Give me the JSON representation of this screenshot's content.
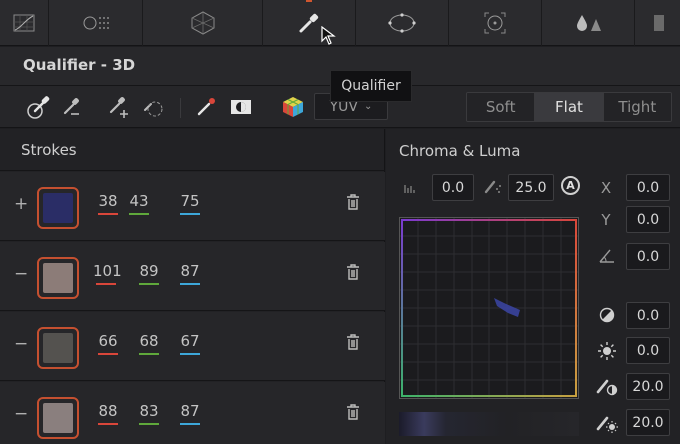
{
  "toolbar": {
    "tabs": [
      {
        "name": "curves-icon"
      },
      {
        "name": "color-warper-icon"
      },
      {
        "name": "hsl-mesh-icon"
      },
      {
        "name": "qualifier-icon",
        "active": true
      },
      {
        "name": "window-icon"
      },
      {
        "name": "tracker-icon"
      },
      {
        "name": "blur-icon"
      },
      {
        "name": "key-icon"
      }
    ],
    "tooltip": "Qualifier"
  },
  "panel": {
    "title": "Qualifier - 3D"
  },
  "tools": {
    "icons": [
      "picker-icon",
      "picker-minus-icon",
      "picker-plus-icon",
      "feather-icon",
      "highlight-pen-icon",
      "invert-mask-icon",
      "color-cube-icon"
    ],
    "color_space": "YUV",
    "softness_options": [
      "Soft",
      "Flat",
      "Tight"
    ],
    "softness_selected": "Flat"
  },
  "strokes": {
    "header": "Strokes",
    "rows": [
      {
        "sign": "+",
        "swatch": "#2a2d66",
        "r": "38",
        "g": "43",
        "b": "75"
      },
      {
        "sign": "−",
        "swatch": "#8c7c78",
        "r": "101",
        "g": "89",
        "b": "87"
      },
      {
        "sign": "−",
        "swatch": "#54524f",
        "r": "66",
        "g": "68",
        "b": "67"
      },
      {
        "sign": "−",
        "swatch": "#8a7f7e",
        "r": "88",
        "g": "83",
        "b": "87"
      }
    ]
  },
  "chroma_luma": {
    "header": "Chroma & Luma",
    "low": "0.0",
    "high": "25.0",
    "auto_label": "A",
    "x_label": "X",
    "x_value": "0.0",
    "y_label": "Y",
    "y_value": "0.0",
    "rotate_value": "0.0",
    "contrast_value": "0.0",
    "brightness_value": "0.0",
    "soft_low_value": "20.0",
    "soft_high_value": "20.0"
  },
  "colors": {
    "accent": "#d0562f",
    "red_channel": "#d9463a",
    "green_channel": "#5fa83b",
    "blue_channel": "#3da7d9"
  }
}
